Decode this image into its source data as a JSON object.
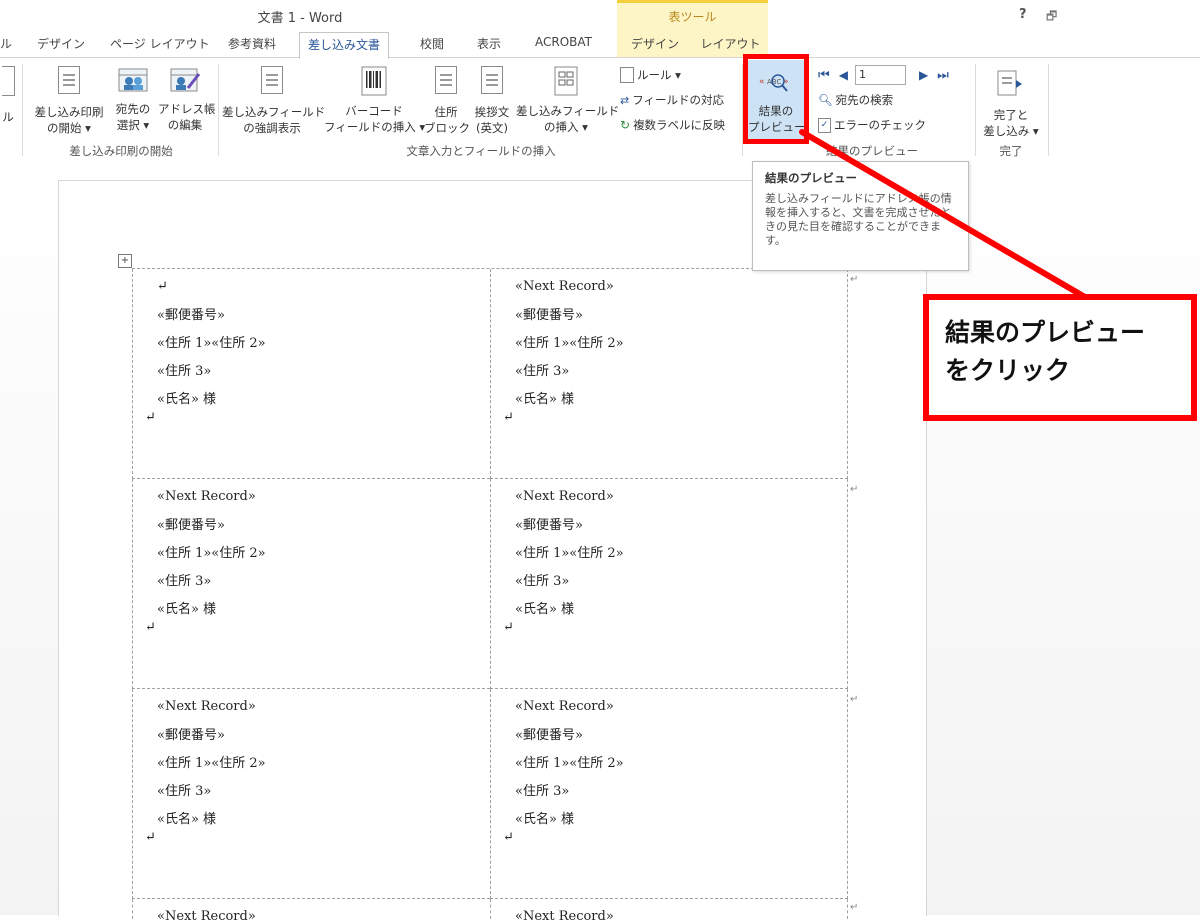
{
  "window": {
    "title": "文書 1 - Word",
    "contextual_tools": "表ツール",
    "help": "?",
    "restore": "🗗"
  },
  "tabs": [
    {
      "label": "ル"
    },
    {
      "label": "デザイン"
    },
    {
      "label": "ページ レイアウト"
    },
    {
      "label": "参考資料"
    },
    {
      "label": "差し込み文書"
    },
    {
      "label": "校閲"
    },
    {
      "label": "表示"
    },
    {
      "label": "ACROBAT"
    },
    {
      "label": "デザイン"
    },
    {
      "label": "レイアウト"
    }
  ],
  "ribbon": {
    "partial_label": "ル",
    "start_merge": {
      "line1": "差し込み印刷",
      "line2": "の開始 ▾"
    },
    "select_recipients": {
      "line1": "宛先の",
      "line2": "選択 ▾"
    },
    "edit_list": {
      "line1": "アドレス帳",
      "line2": "の編集"
    },
    "group_start": "差し込み印刷の開始",
    "highlight_fields": {
      "line1": "差し込みフィールド",
      "line2": "の強調表示"
    },
    "barcode": {
      "line1": "バーコード",
      "line2": "フィールドの挿入 ▾"
    },
    "address_block": {
      "line1": "住所",
      "line2": "ブロック"
    },
    "greeting": {
      "line1": "挨拶文",
      "line2": "(英文)"
    },
    "insert_field": {
      "line1": "差し込みフィールド",
      "line2": "の挿入 ▾"
    },
    "rules": "ルール ▾",
    "match_fields": "フィールドの対応",
    "update_labels": "複数ラベルに反映",
    "group_write": "文章入力とフィールドの挿入",
    "preview_results": {
      "line1": "結果の",
      "line2": "プレビュー"
    },
    "record_number": "1",
    "find_recipient": "宛先の検索",
    "check_errors": "エラーのチェック",
    "group_preview": "結果のプレビュー",
    "finish": {
      "line1": "完了と",
      "line2": "差し込み ▾"
    },
    "group_finish": "完了"
  },
  "tooltip": {
    "title": "結果のプレビュー",
    "body": "差し込みフィールドにアドレス帳の情報を挿入すると、文書を完成させたときの見た目を確認することができます。"
  },
  "labels": {
    "first_blank": "↵",
    "next_record": "«Next Record»",
    "postal": "«郵便番号»",
    "address12": "«住所 1»«住所 2»",
    "address3": "«住所 3»",
    "name": "«氏名» 様",
    "para": "↵"
  },
  "callout": {
    "text": "結果のプレビュー\nをクリック"
  }
}
